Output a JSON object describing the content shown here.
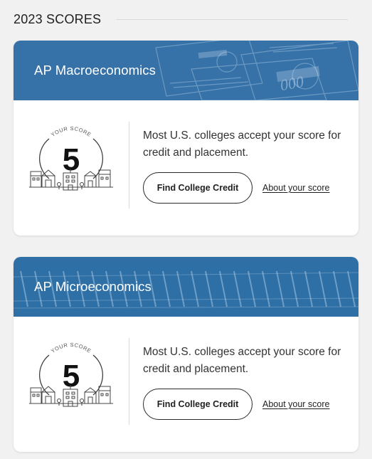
{
  "header": {
    "title": "2023 SCORES"
  },
  "cards": [
    {
      "course": "AP Macroeconomics",
      "score_label": "YOUR SCORE",
      "score": "5",
      "message": "Most U.S. colleges accept your score for credit and placement.",
      "primary_button": "Find College Credit",
      "secondary_link": "About your score",
      "banner_theme": "money-icon"
    },
    {
      "course": "AP Microeconomics",
      "score_label": "YOUR SCORE",
      "score": "5",
      "message": "Most U.S. colleges accept your score for credit and placement.",
      "primary_button": "Find College Credit",
      "secondary_link": "About your score",
      "banner_theme": "shopping-carts-icon"
    }
  ],
  "colors": {
    "banner_blue": "#3a78ad",
    "page_bg": "#f1f1f1",
    "text": "#1f1f1f"
  }
}
